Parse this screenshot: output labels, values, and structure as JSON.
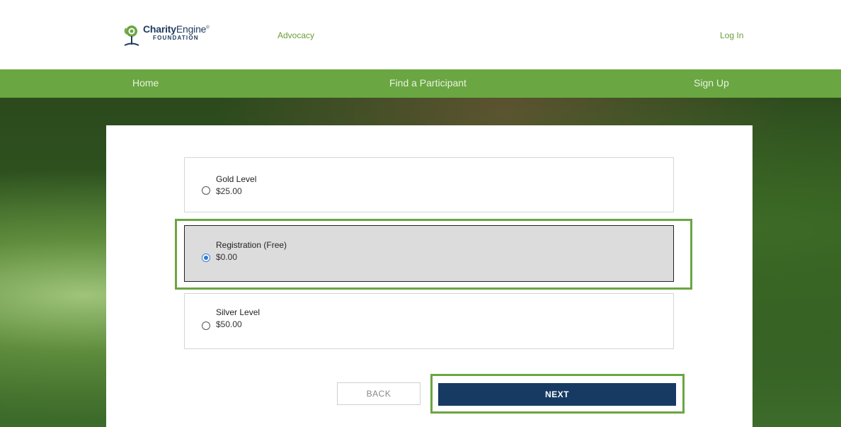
{
  "brand": {
    "name_part1": "Charity",
    "name_part2": "Engine",
    "trademark": "®",
    "subtitle": "FOUNDATION"
  },
  "header": {
    "advocacy_link": "Advocacy",
    "login_link": "Log In"
  },
  "nav": {
    "home": "Home",
    "find_participant": "Find a Participant",
    "sign_up": "Sign Up"
  },
  "options": [
    {
      "title": "Gold Level",
      "price": "$25.00",
      "selected": false
    },
    {
      "title": "Registration (Free)",
      "price": "$0.00",
      "selected": true
    },
    {
      "title": "Silver Level",
      "price": "$50.00",
      "selected": false
    }
  ],
  "buttons": {
    "back": "BACK",
    "next": "NEXT"
  },
  "colors": {
    "accent_green": "#6aa642",
    "next_button": "#173a63",
    "selected_bg": "#dcdcdc"
  }
}
